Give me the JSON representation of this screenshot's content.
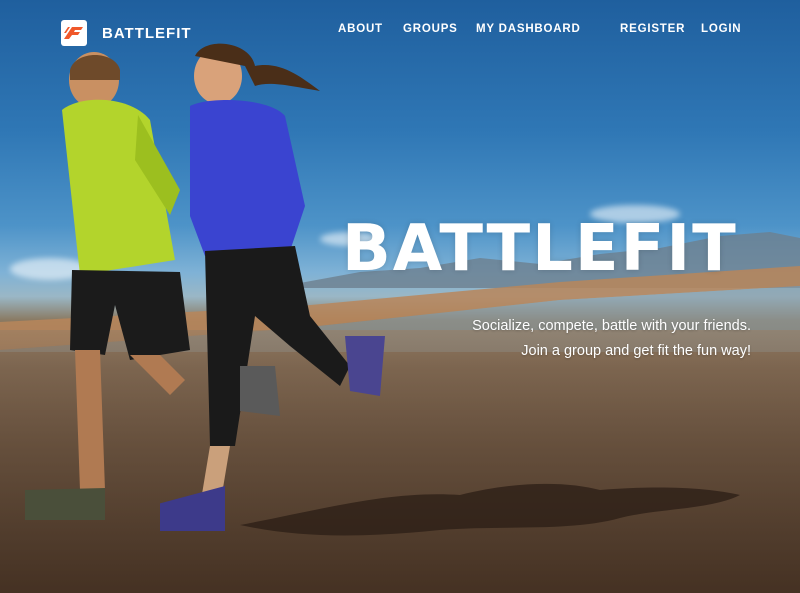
{
  "brand": {
    "logo_text": "F",
    "name": "BATTLEFIT"
  },
  "nav": {
    "links": [
      {
        "label": "ABOUT"
      },
      {
        "label": "GROUPS"
      },
      {
        "label": "MY DASHBOARD"
      },
      {
        "label": "REGISTER"
      },
      {
        "label": "LOGIN"
      }
    ]
  },
  "hero": {
    "title": "BATTLEFIT",
    "tagline_1": "Socialize, compete, battle with your friends.",
    "tagline_2": "Join a group and get fit the fun way!"
  },
  "colors": {
    "logo_accent": "#f0582a",
    "text": "#ffffff",
    "sky": "#2f77b5",
    "sand": "#5c4634"
  }
}
